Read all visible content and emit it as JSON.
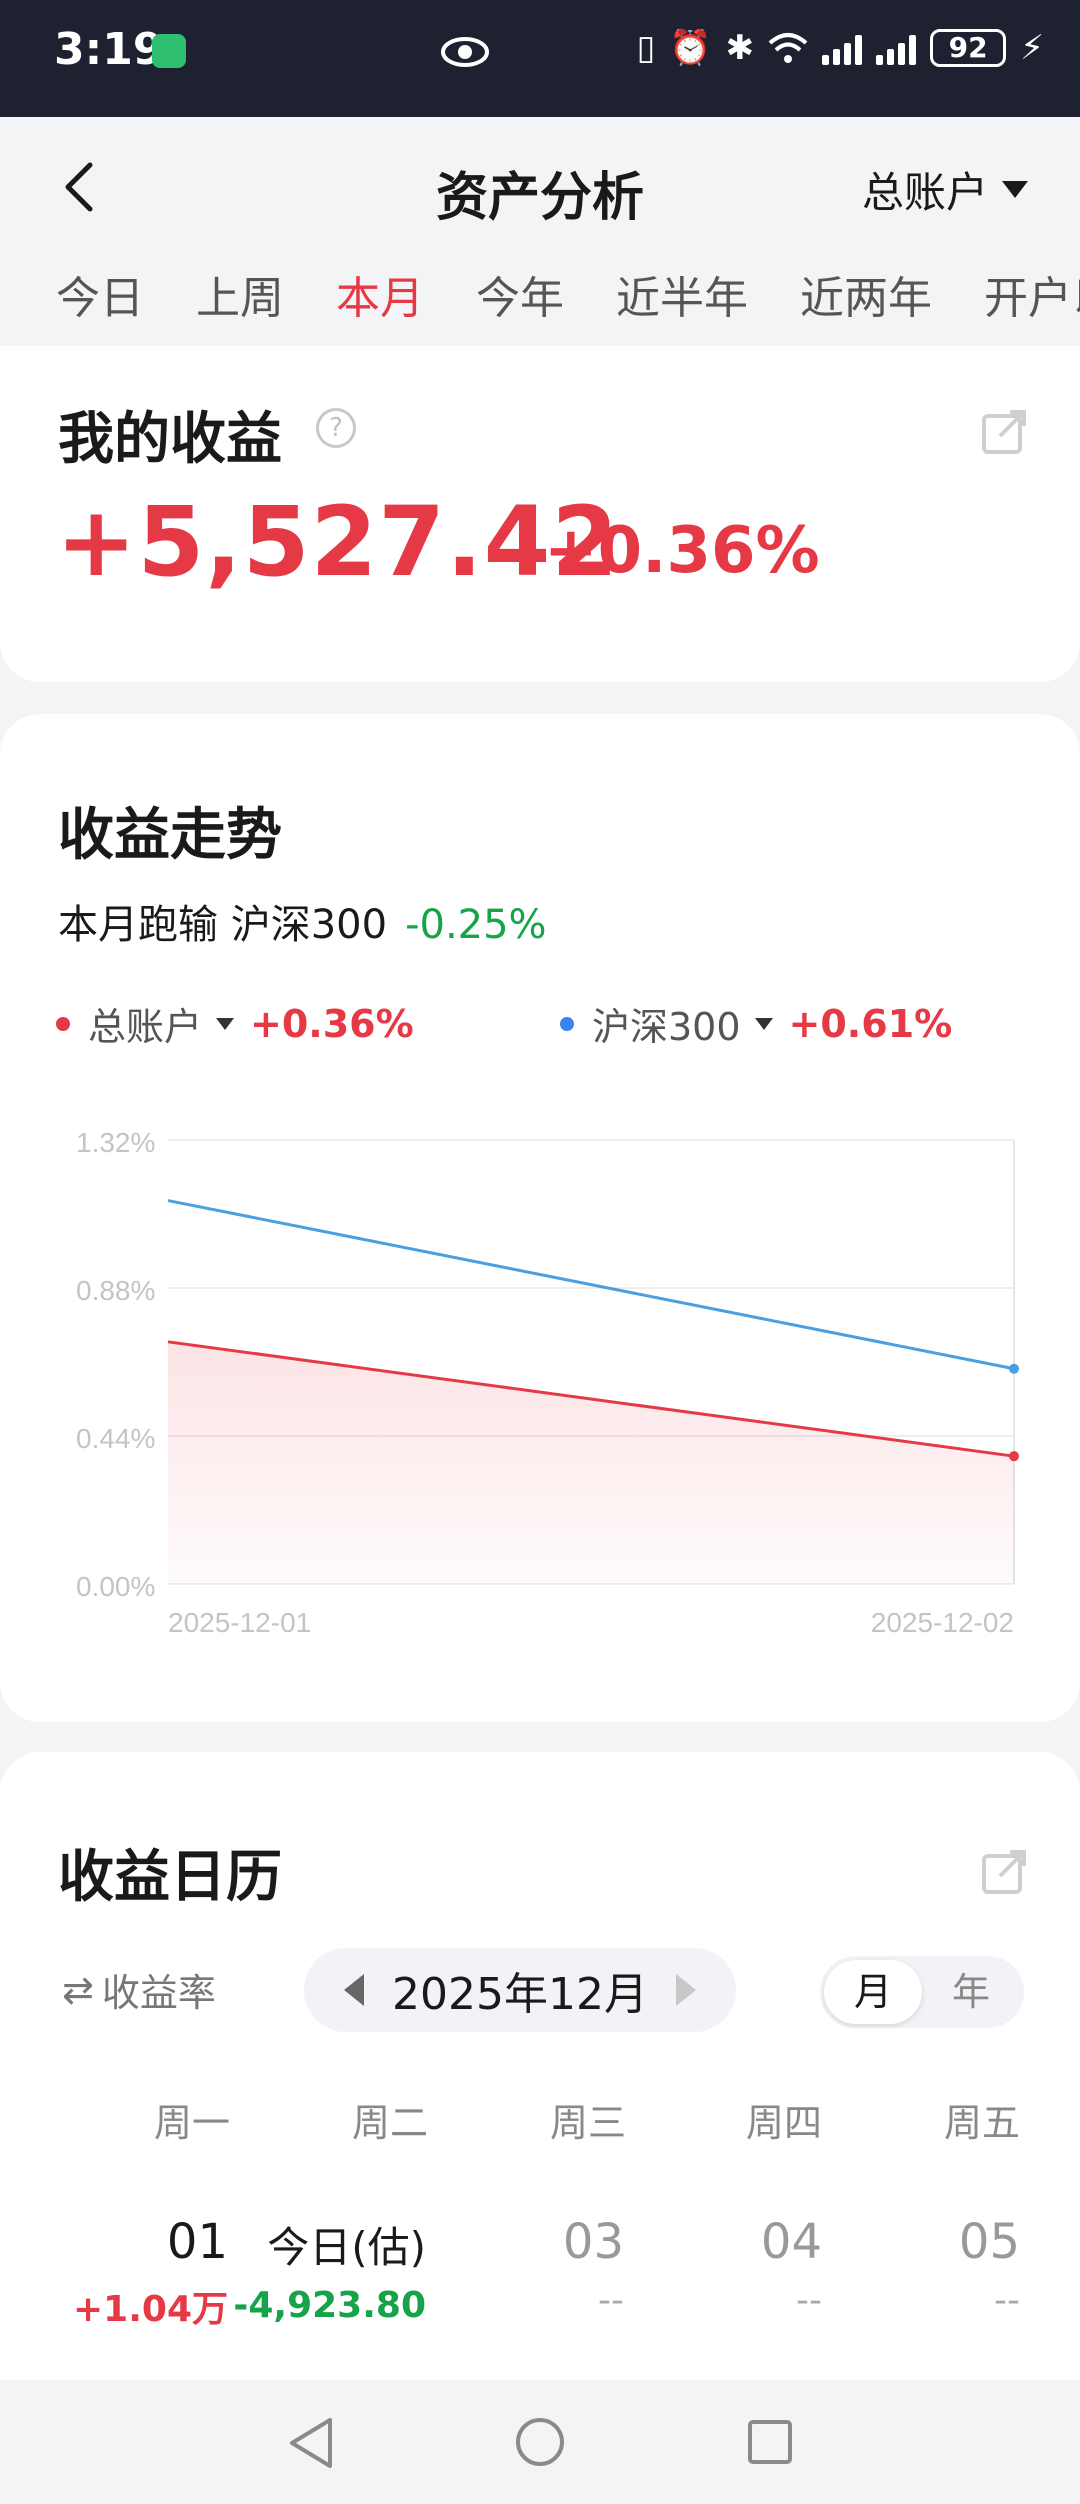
{
  "status_bar": {
    "time": "3:19",
    "battery": "92"
  },
  "header": {
    "title": "资产分析",
    "account": "总账户",
    "tabs": [
      {
        "label": "今日",
        "active": false
      },
      {
        "label": "上周",
        "active": false
      },
      {
        "label": "本月",
        "active": true
      },
      {
        "label": "今年",
        "active": false
      },
      {
        "label": "近半年",
        "active": false
      },
      {
        "label": "近两年",
        "active": false
      },
      {
        "label": "开户以来",
        "active": false
      }
    ]
  },
  "profit": {
    "title": "我的收益",
    "amount": "+5,527.42",
    "percent": "+0.36%"
  },
  "trend": {
    "title": "收益走势",
    "compare_text": "本月跑输 沪深300",
    "compare_value": "-0.25%",
    "legend": [
      {
        "name": "总账户",
        "value": "+0.36%",
        "color": "#e63946"
      },
      {
        "name": "沪深300",
        "value": "+0.61%",
        "color": "#3b82f6"
      }
    ]
  },
  "chart_data": {
    "type": "line",
    "x": [
      "2025-12-01",
      "2025-12-02"
    ],
    "series": [
      {
        "name": "总账户",
        "values": [
          0.72,
          0.38
        ],
        "color": "#e63946"
      },
      {
        "name": "沪深300",
        "values": [
          1.14,
          0.64
        ],
        "color": "#4a9fe0"
      }
    ],
    "ylim": [
      0,
      1.32
    ],
    "yticks": [
      "1.32%",
      "0.88%",
      "0.44%",
      "0.00%"
    ],
    "ytick_values": [
      1.32,
      0.88,
      0.44,
      0.0
    ],
    "xtick_labels": [
      "2025-12-01",
      "2025-12-02"
    ],
    "grid": true
  },
  "calendar": {
    "title": "收益日历",
    "rate_toggle": "收益率",
    "month": "2025年12月",
    "period_options": [
      {
        "label": "月",
        "active": true
      },
      {
        "label": "年",
        "active": false
      }
    ],
    "weekdays": [
      "周一",
      "周二",
      "周三",
      "周四",
      "周五"
    ],
    "days": [
      {
        "day": "01",
        "value": "+1.04万",
        "kind": "pos"
      },
      {
        "day": "今日(估)",
        "value": "-4,923.80",
        "kind": "neg"
      },
      {
        "day": "03",
        "value": "--",
        "kind": "none"
      },
      {
        "day": "04",
        "value": "--",
        "kind": "none"
      },
      {
        "day": "05",
        "value": "--",
        "kind": "none"
      }
    ]
  }
}
